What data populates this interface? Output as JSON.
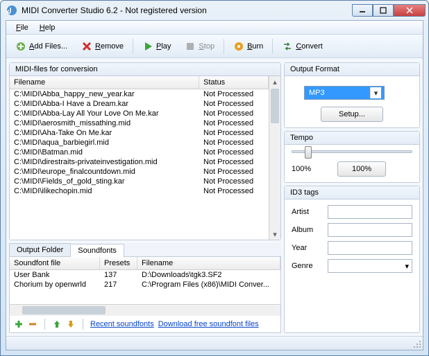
{
  "window": {
    "title": "MIDI Converter Studio 6.2 - Not registered version"
  },
  "menu": {
    "file": "File",
    "help": "Help"
  },
  "toolbar": {
    "add": "Add Files...",
    "remove": "Remove",
    "play": "Play",
    "stop": "Stop",
    "burn": "Burn",
    "convert": "Convert"
  },
  "filelist": {
    "title": "MIDI-files for conversion",
    "col_filename": "Filename",
    "col_status": "Status",
    "rows": [
      {
        "file": "C:\\MIDI\\Abba_happy_new_year.kar",
        "status": "Not Processed"
      },
      {
        "file": "C:\\MIDI\\Abba-I Have a Dream.kar",
        "status": "Not Processed"
      },
      {
        "file": "C:\\MIDI\\Abba-Lay All Your Love On Me.kar",
        "status": "Not Processed"
      },
      {
        "file": "C:\\MIDI\\aerosmith_missathing.mid",
        "status": "Not Processed"
      },
      {
        "file": "C:\\MIDI\\Aha-Take On Me.kar",
        "status": "Not Processed"
      },
      {
        "file": "C:\\MIDI\\aqua_barbiegirl.mid",
        "status": "Not Processed"
      },
      {
        "file": "C:\\MIDI\\Batman.mid",
        "status": "Not Processed"
      },
      {
        "file": "C:\\MIDI\\direstraits-privateinvestigation.mid",
        "status": "Not Processed"
      },
      {
        "file": "C:\\MIDI\\europe_finalcountdown.mid",
        "status": "Not Processed"
      },
      {
        "file": "C:\\MIDI\\Fields_of_gold_sting.kar",
        "status": "Not Processed"
      },
      {
        "file": "C:\\MIDI\\ilikechopin.mid",
        "status": "Not Processed"
      }
    ]
  },
  "tabs": {
    "output_folder": "Output Folder",
    "soundfonts": "Soundfonts"
  },
  "soundfonts": {
    "col_name": "Soundfont file",
    "col_presets": "Presets",
    "col_filename": "Filename",
    "rows": [
      {
        "name": "User Bank",
        "presets": "137",
        "file": "D:\\Downloads\\tgk3.SF2"
      },
      {
        "name": "Chorium by openwrld",
        "presets": "217",
        "file": "C:\\Program Files (x86)\\MIDI Conver..."
      }
    ],
    "recent": "Recent soundfonts",
    "download": "Download free soundfont files"
  },
  "output": {
    "title": "Output Format",
    "format": "MP3",
    "setup": "Setup..."
  },
  "tempo": {
    "title": "Tempo",
    "value": "100%",
    "reset": "100%"
  },
  "id3": {
    "title": "ID3 tags",
    "artist_label": "Artist",
    "album_label": "Album",
    "year_label": "Year",
    "genre_label": "Genre",
    "artist": "",
    "album": "",
    "year": "",
    "genre": ""
  }
}
